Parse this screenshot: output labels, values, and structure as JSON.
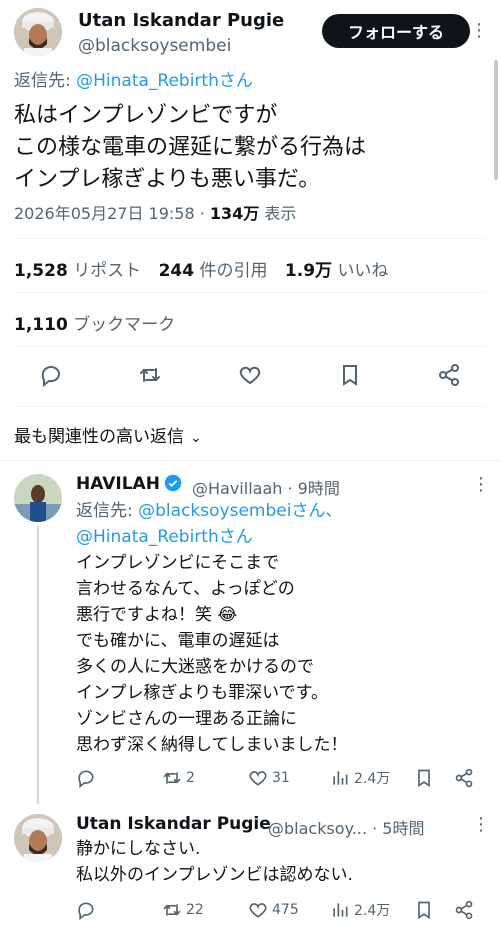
{
  "main_tweet": {
    "author_name": "Utan Iskandar Pugie",
    "author_handle": "@blacksoysembei",
    "follow_label": "フォローする",
    "reply_prefix": "返信先: ",
    "reply_to": "@Hinata_Rebirthさん",
    "text": "私はインプレゾンビですが\nこの様な電車の遅延に繋がる行為は\nインプレ稼ぎよりも悪い事だ。",
    "timestamp": "2026年05月27日 19:58 · ",
    "views": "134万",
    "views_label": " 表示",
    "reposts": "1,528",
    "reposts_label": "リポスト",
    "quotes": "244",
    "quotes_label": "件の引用",
    "likes": "1.9万",
    "likes_label": "いいね",
    "bookmarks": "1,110",
    "bookmarks_label": "ブックマーク"
  },
  "sort": {
    "label": "最も関連性の高い返信",
    "chevron": "⌄"
  },
  "replies": [
    {
      "author_name": "HAVILAH",
      "handle_time": "@Havillaah · 9時間",
      "reply_prefix": "返信先: ",
      "reply_to_1": "@blacksoysembeiさん、",
      "reply_to_2": "@Hinata_Rebirthさん",
      "text": "インプレゾンビにそこまで\n言わせるなんて、よっぽどの\n悪行ですよね！笑 😂\nでも確かに、電車の遅延は\n多くの人に大迷惑をかけるので\nインプレ稼ぎよりも罪深いです。\nゾンビさんの一理ある正論に\n思わず深く納得してしまいました！",
      "reposts": "2",
      "likes": "31",
      "views": "2.4万"
    },
    {
      "author_name": "Utan Iskandar Pugie",
      "handle_time": "@blacksoy... · 5時間",
      "text": "静かにしなさい.\n私以外のインプレゾンビは認めない.",
      "reposts": "22",
      "likes": "475",
      "views": "2.4万"
    }
  ],
  "icons": {
    "kebab": "⋮"
  },
  "colors": {
    "accent": "#1d9bf0",
    "muted": "#536471",
    "text": "#0f1419"
  }
}
